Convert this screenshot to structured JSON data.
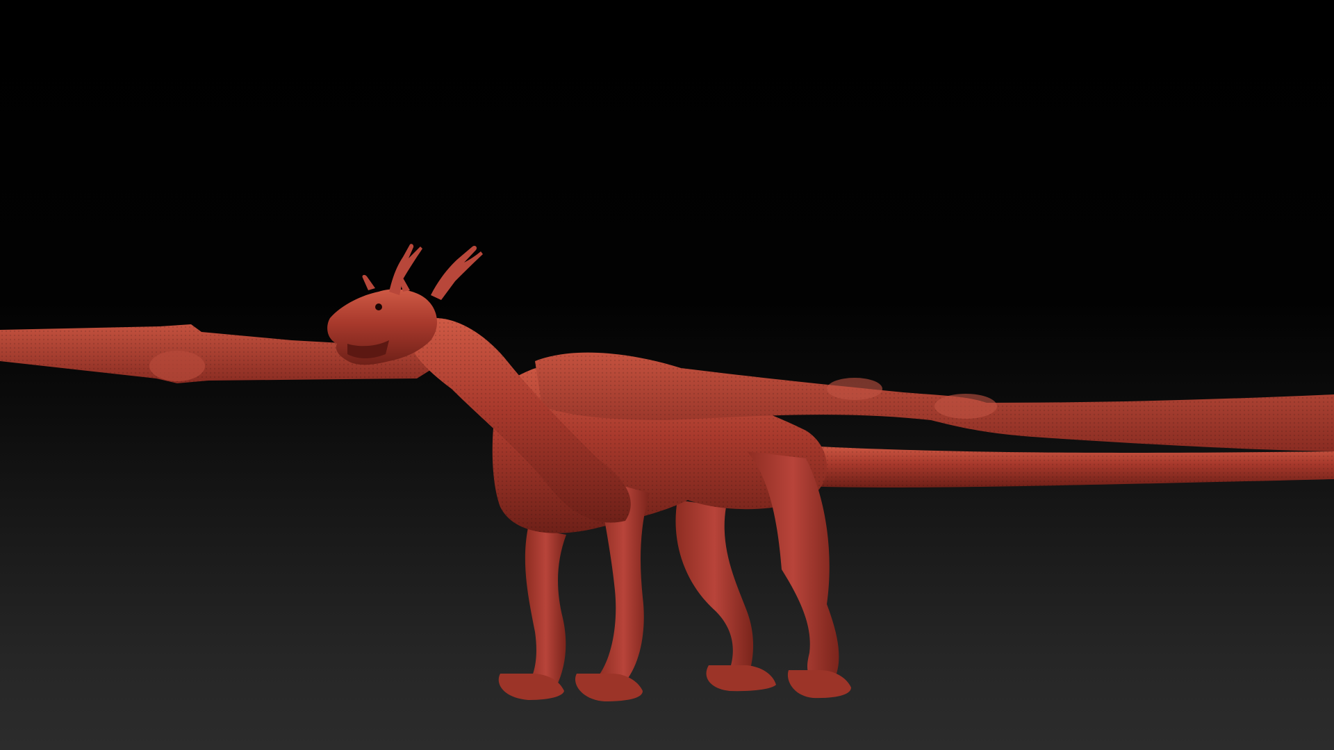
{
  "viewport": {
    "background_top": "#000000",
    "background_bottom": "#2c2c2c"
  },
  "model": {
    "subject": "dragon-sculpt",
    "material_color": "#a8392c",
    "highlight_color": "#cf5a45",
    "shadow_color": "#5c1812"
  }
}
